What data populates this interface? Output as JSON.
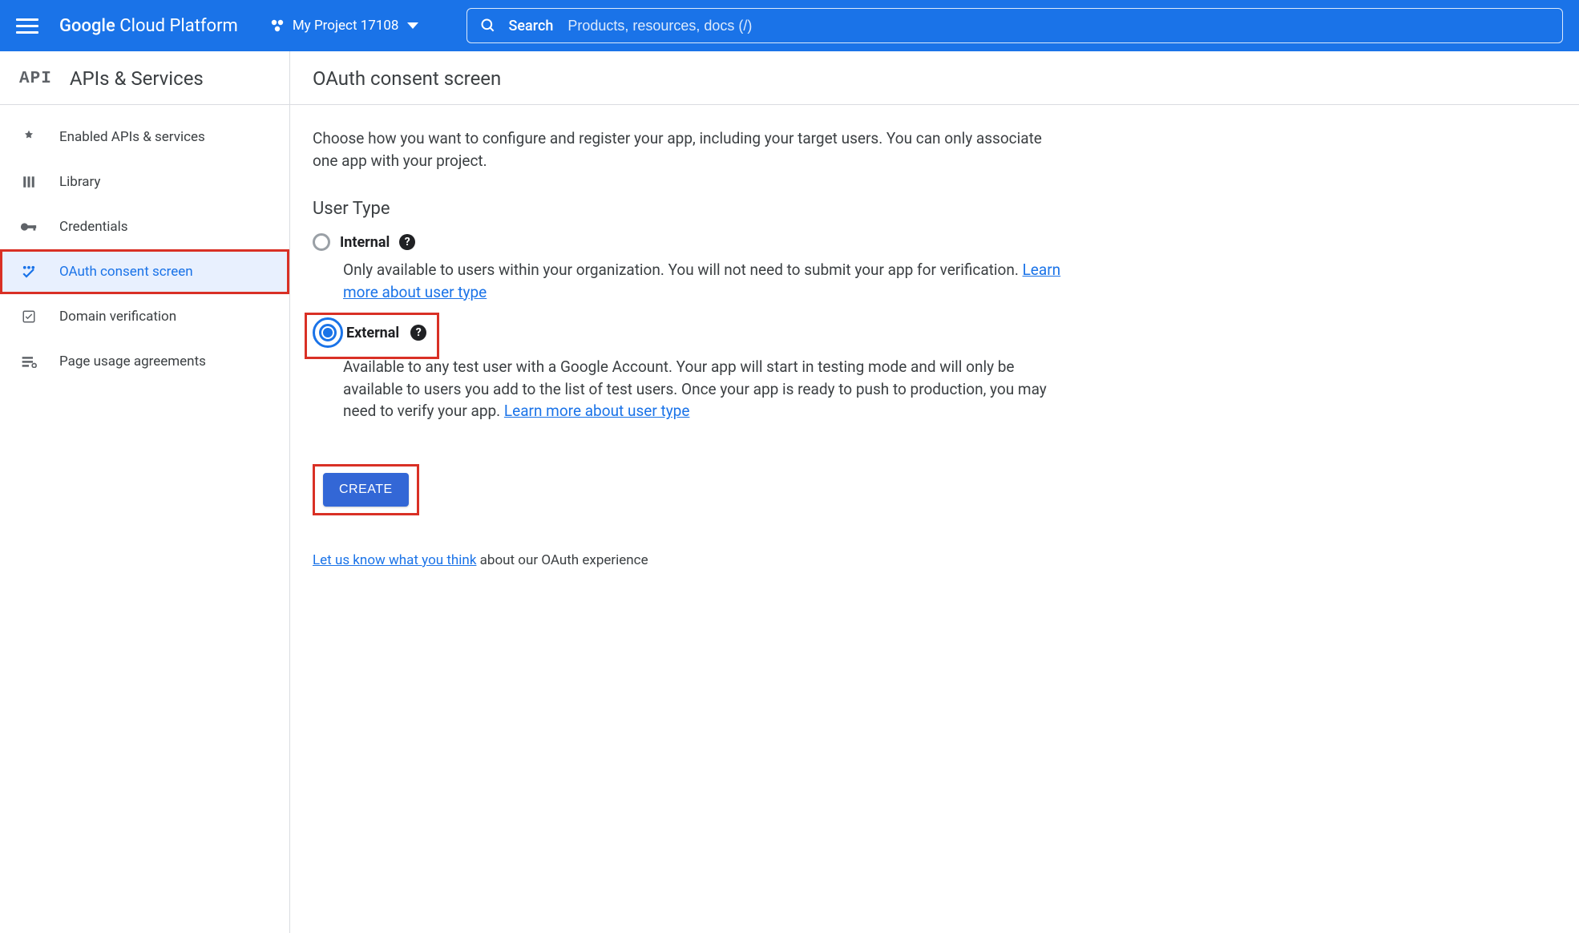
{
  "header": {
    "platform_label_bold": "Google",
    "platform_label_rest": " Cloud Platform",
    "project_name": "My Project 17108",
    "search_label": "Search",
    "search_placeholder": "Products, resources, docs (/)"
  },
  "sidebar": {
    "section_code": "API",
    "section_title": "APIs & Services",
    "items": [
      {
        "icon": "enabled-apis-icon",
        "label": "Enabled APIs & services"
      },
      {
        "icon": "library-icon",
        "label": "Library"
      },
      {
        "icon": "credentials-icon",
        "label": "Credentials"
      },
      {
        "icon": "oauth-consent-icon",
        "label": "OAuth consent screen",
        "active": true,
        "highlighted": true
      },
      {
        "icon": "domain-verify-icon",
        "label": "Domain verification"
      },
      {
        "icon": "page-usage-icon",
        "label": "Page usage agreements"
      }
    ]
  },
  "main": {
    "title": "OAuth consent screen",
    "intro": "Choose how you want to configure and register your app, including your target users. You can only associate one app with your project.",
    "user_type_heading": "User Type",
    "options": {
      "internal": {
        "label": "Internal",
        "desc_pre": "Only available to users within your organization. You will not need to submit your app for verification. ",
        "learn_more": "Learn more about user type"
      },
      "external": {
        "label": "External",
        "desc_pre": "Available to any test user with a Google Account. Your app will start in testing mode and will only be available to users you add to the list of test users. Once your app is ready to push to production, you may need to verify your app. ",
        "learn_more": "Learn more about user type"
      }
    },
    "create_label": "CREATE",
    "feedback_link": "Let us know what you think",
    "feedback_rest": " about our OAuth experience"
  }
}
